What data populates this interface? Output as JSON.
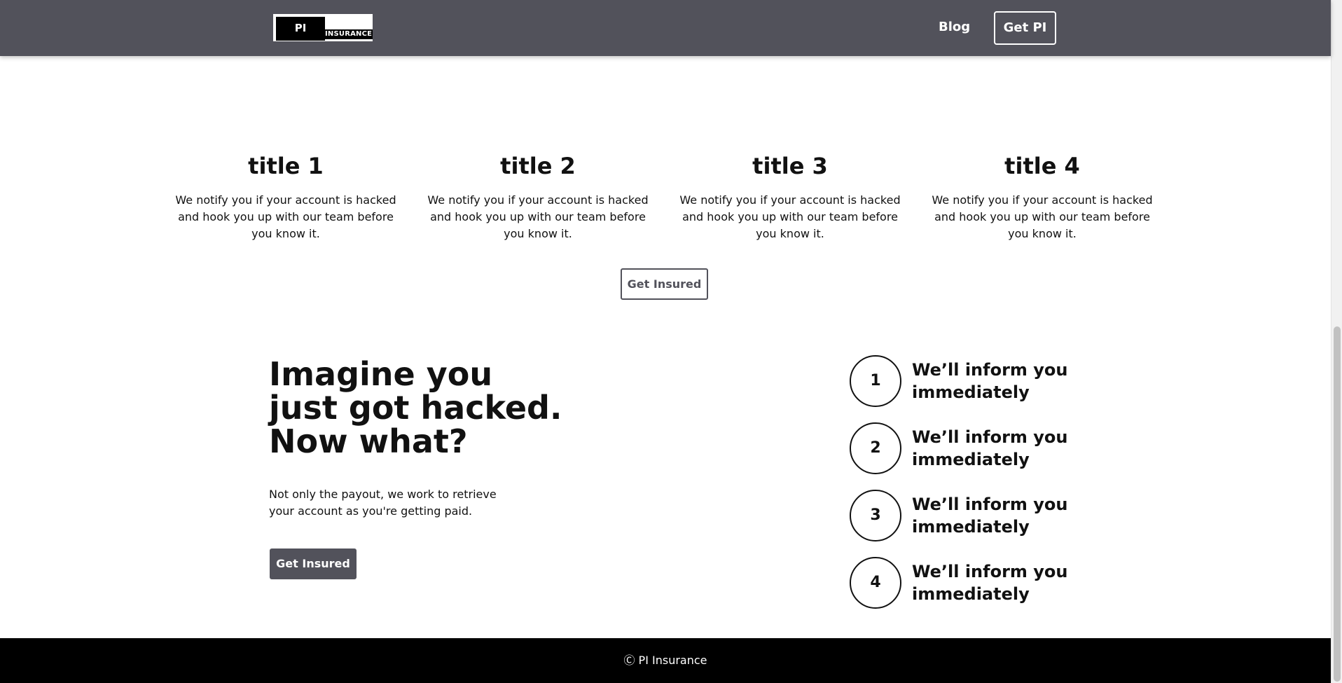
{
  "header": {
    "logo_main": "PI",
    "logo_sub": "INSURANCE",
    "nav_blog": "Blog",
    "nav_cta": "Get PI"
  },
  "features": [
    {
      "title": "title 1",
      "text": "We notify you if your account is hacked and hook you up with our team before you know it."
    },
    {
      "title": "title 2",
      "text": "We notify you if your account is hacked and hook you up with our team before you know it."
    },
    {
      "title": "title 3",
      "text": "We notify you if your account is hacked and hook you up with our team before you know it."
    },
    {
      "title": "title 4",
      "text": "We notify you if your account is hacked and hook you up with our team before you know it."
    }
  ],
  "features_cta": "Get Insured",
  "hacked": {
    "title": "Imagine you just got hacked. Now what?",
    "text": "Not only the payout, we work to retrieve your account as you're getting paid.",
    "cta": "Get Insured"
  },
  "steps": [
    {
      "number": "1",
      "text": "We’ll inform you immediately"
    },
    {
      "number": "2",
      "text": "We’ll inform you immediately"
    },
    {
      "number": "3",
      "text": "We’ll inform you immediately"
    },
    {
      "number": "4",
      "text": "We’ll inform you immediately"
    }
  ],
  "footer": {
    "text": "Ⓒ PI Insurance"
  },
  "colors": {
    "header_bg": "#52525b",
    "footer_bg": "#000000",
    "accent": "#52525b"
  }
}
